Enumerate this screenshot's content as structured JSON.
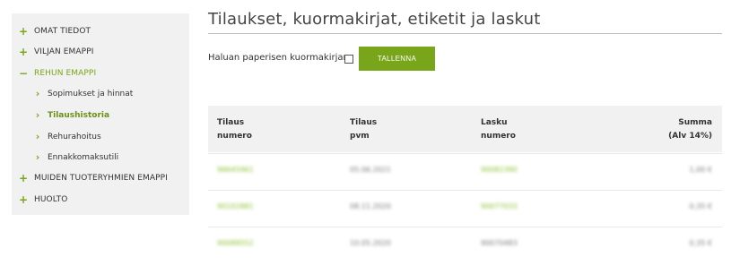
{
  "sidebar": {
    "items": [
      {
        "label": "OMAT TIEDOT",
        "icon": "plus-icon",
        "glyph": "+"
      },
      {
        "label": "VILJAN EMAPPI",
        "icon": "plus-icon",
        "glyph": "+"
      },
      {
        "label": "REHUN EMAPPI",
        "icon": "minus-icon",
        "glyph": "−"
      },
      {
        "label": "Sopimukset ja hinnat",
        "icon": "chevron-right-icon",
        "glyph": "›"
      },
      {
        "label": "Tilaushistoria",
        "icon": "chevron-right-icon",
        "glyph": "›"
      },
      {
        "label": "Rehurahoitus",
        "icon": "chevron-right-icon",
        "glyph": "›"
      },
      {
        "label": "Ennakkomaksutili",
        "icon": "chevron-right-icon",
        "glyph": "›"
      },
      {
        "label": "MUIDEN TUOTERYHMIEN EMAPPI",
        "icon": "plus-icon",
        "glyph": "+"
      },
      {
        "label": "HUOLTO",
        "icon": "plus-icon",
        "glyph": "+"
      }
    ]
  },
  "main": {
    "title": "Tilaukset, kuormakirjat, etiketit ja laskut",
    "paper_label": "Haluan paperisen kuormakirjan",
    "save_label": "TALLENNA"
  },
  "table": {
    "headers": [
      {
        "line1": "Tilaus",
        "line2": "numero"
      },
      {
        "line1": "Tilaus",
        "line2": "pvm"
      },
      {
        "line1": "Lasku",
        "line2": "numero"
      },
      {
        "line1": "Summa",
        "line2": "(Alv 14%)"
      }
    ],
    "rows": [
      {
        "order_no": "96645961",
        "date": "05.06.2021",
        "invoice_no": "90082390",
        "sum": "1,00 €"
      },
      {
        "order_no": "90102881",
        "date": "08.11.2020",
        "invoice_no": "90077033",
        "sum": "0,35 €"
      },
      {
        "order_no": "90088552",
        "date": "10.05.2020",
        "invoice_no": "90070483",
        "sum": "0,35 €"
      }
    ]
  },
  "colors": {
    "accent": "#79a51a",
    "sidebar_bg": "#f1f1f1",
    "header_bg": "#f1f1f1"
  }
}
